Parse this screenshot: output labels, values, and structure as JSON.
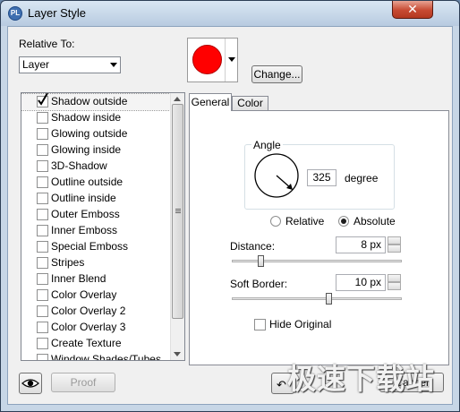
{
  "window": {
    "title": "Layer Style",
    "app_icon_text": "PL",
    "close_glyph": "✕"
  },
  "relative_to": {
    "label": "Relative To:",
    "selected": "Layer"
  },
  "color_swatch": {
    "color": "#ff0000"
  },
  "change_button": "Change...",
  "effects": [
    {
      "label": "Shadow outside",
      "checked": true,
      "selected": true
    },
    {
      "label": "Shadow inside",
      "checked": false
    },
    {
      "label": "Glowing outside",
      "checked": false
    },
    {
      "label": "Glowing inside",
      "checked": false
    },
    {
      "label": "3D-Shadow",
      "checked": false
    },
    {
      "label": "Outline outside",
      "checked": false
    },
    {
      "label": "Outline inside",
      "checked": false
    },
    {
      "label": "Outer Emboss",
      "checked": false
    },
    {
      "label": "Inner Emboss",
      "checked": false
    },
    {
      "label": "Special Emboss",
      "checked": false
    },
    {
      "label": "Stripes",
      "checked": false
    },
    {
      "label": "Inner Blend",
      "checked": false
    },
    {
      "label": "Color Overlay",
      "checked": false
    },
    {
      "label": "Color Overlay 2",
      "checked": false
    },
    {
      "label": "Color Overlay 3",
      "checked": false
    },
    {
      "label": "Create Texture",
      "checked": false
    },
    {
      "label": "Window Shades/Tubes",
      "checked": false
    }
  ],
  "tabs": [
    "General",
    "Color"
  ],
  "angle": {
    "label": "Angle",
    "value": "325",
    "unit": "degree"
  },
  "mode": {
    "relative": "Relative",
    "absolute": "Absolute",
    "selected": "Absolute"
  },
  "distance": {
    "label": "Distance:",
    "value": "8 px",
    "slider_fraction": 0.17
  },
  "soft_border": {
    "label": "Soft Border:",
    "value": "10 px",
    "slider_fraction": 0.57
  },
  "hide_original": {
    "label": "Hide Original",
    "checked": false
  },
  "proof_button": "Proof",
  "cancel_button": "Cancel",
  "watermark": "极速下载站"
}
